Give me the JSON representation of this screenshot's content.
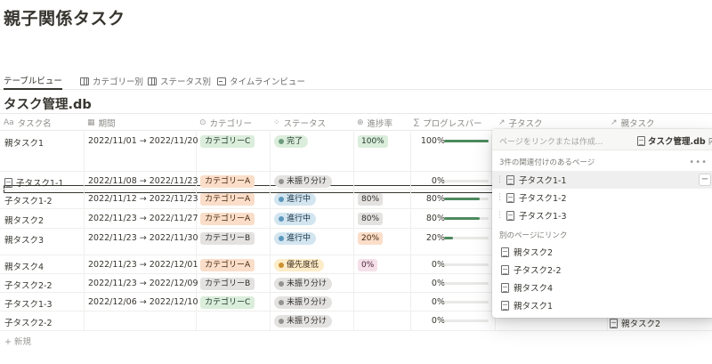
{
  "page_title": "親子関係タスク",
  "views": [
    {
      "label": "テーブルビュー",
      "icon": "table-icon"
    },
    {
      "label": "カテゴリー別",
      "icon": "board-icon"
    },
    {
      "label": "ステータス別",
      "icon": "board-icon"
    },
    {
      "label": "タイムラインビュー",
      "icon": "timeline-icon"
    }
  ],
  "db_title": "タスク管理.db",
  "columns": {
    "name": {
      "icon": "Aa",
      "label": "タスク名"
    },
    "period": {
      "icon": "▦",
      "label": "期間"
    },
    "category": {
      "icon": "⊙",
      "label": "カテゴリー"
    },
    "status": {
      "icon": "⁘",
      "label": "ステータス"
    },
    "rate": {
      "icon": "⊕",
      "label": "進捗率"
    },
    "progress": {
      "icon": "∑",
      "label": "プログレスバー"
    },
    "child": {
      "icon": "↗",
      "label": "子タスク"
    },
    "parent": {
      "icon": "↗",
      "label": "親タスク"
    }
  },
  "rows": [
    {
      "name": "親タスク1",
      "period": "2022/11/01 → 2022/11/20",
      "category": "カテゴリーC",
      "status": "完了",
      "rate": "100%",
      "progress": "100%",
      "progress_value": 1.0
    },
    {
      "name": "子タスク1-1",
      "period": "2022/11/08 → 2022/11/23",
      "category": "カテゴリーA",
      "status": "未振り分け",
      "rate": "",
      "progress": "0%",
      "progress_value": 0.0
    },
    {
      "name": "子タスク1-2",
      "period": "2022/11/12 → 2022/11/23",
      "category": "カテゴリーA",
      "status": "進行中",
      "rate": "80%",
      "progress": "80%",
      "progress_value": 0.8
    },
    {
      "name": "親タスク2",
      "period": "2022/11/23 → 2022/11/27",
      "category": "カテゴリーA",
      "status": "進行中",
      "rate": "80%",
      "progress": "80%",
      "progress_value": 0.8
    },
    {
      "name": "親タスク3",
      "period": "2022/11/23 → 2022/11/30",
      "category": "カテゴリーB",
      "status": "進行中",
      "rate": "20%",
      "progress": "20%",
      "progress_value": 0.2
    },
    {
      "name": "親タスク4",
      "period": "2022/11/23 → 2022/12/01",
      "category": "カテゴリーA",
      "status": "優先度低",
      "rate": "0%",
      "progress": "0%",
      "progress_value": 0.0
    },
    {
      "name": "子タスク2-2",
      "period": "2022/11/23 → 2022/12/09",
      "category": "カテゴリーB",
      "status": "未振り分け",
      "rate": "",
      "progress": "0%",
      "progress_value": 0.0
    },
    {
      "name": "子タスク1-3",
      "period": "2022/12/06 → 2022/12/10",
      "category": "カテゴリーC",
      "status": "未振り分け",
      "rate": "",
      "progress": "0%",
      "progress_value": 0.0
    },
    {
      "name": "子タスク2-2",
      "period": "",
      "category": "",
      "status": "未振り分け",
      "rate": "",
      "progress": "0%",
      "progress_value": 0.0
    }
  ],
  "new_label": "+ 新規",
  "popup": {
    "placeholder": "ページをリンクまたは作成...",
    "db_name": "タスク管理.db",
    "db_suffix": "内",
    "related_header": "3件の関連付けのあるページ",
    "more": "•••",
    "related": [
      "子タスク1-1",
      "子タスク1-2",
      "子タスク1-3"
    ],
    "link_header": "別のページにリンク",
    "links": [
      "親タスク2",
      "子タスク2-2",
      "親タスク4",
      "親タスク1"
    ]
  },
  "behind_parent_value": "親タスク2",
  "colors": {
    "bar_fill": "#4d8a5e",
    "status_done": "#dbeddb",
    "status_progress": "#d3e5ef",
    "status_unassigned": "#e3e2e0",
    "status_low_priority": "#fdecc8"
  }
}
